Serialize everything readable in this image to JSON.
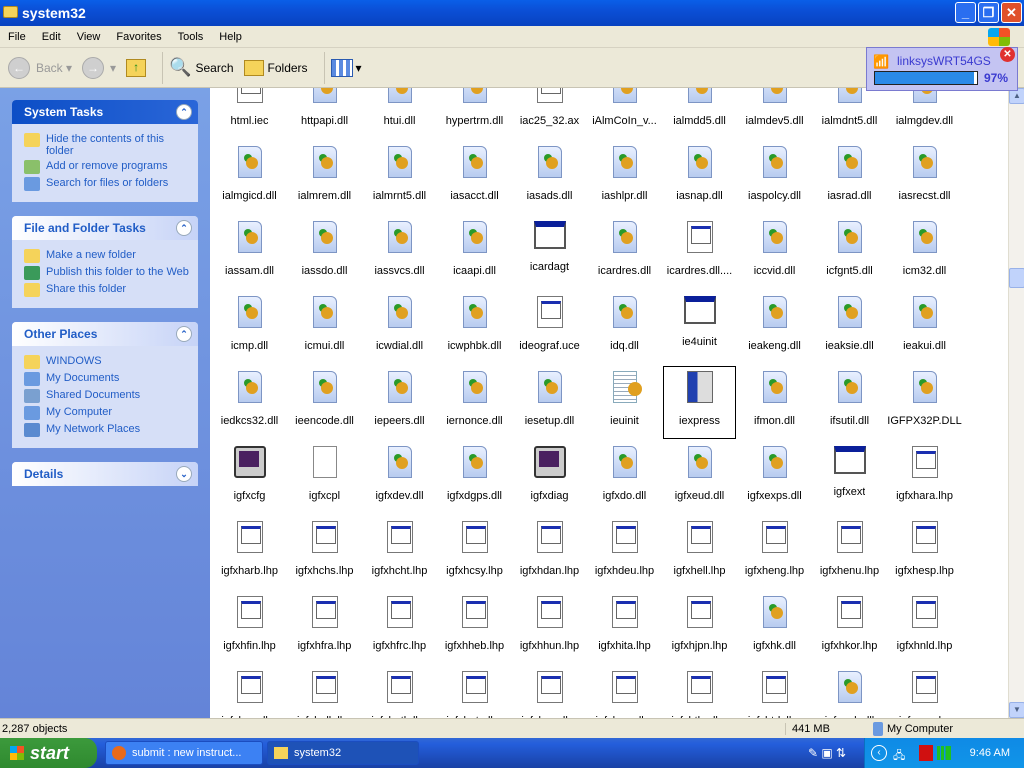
{
  "window": {
    "title": "system32"
  },
  "menu": [
    "File",
    "Edit",
    "View",
    "Favorites",
    "Tools",
    "Help"
  ],
  "toolbar": {
    "back": "Back",
    "search": "Search",
    "folders": "Folders"
  },
  "panels": [
    {
      "title": "System Tasks",
      "items": [
        "Hide the contents of this folder",
        "Add or remove programs",
        "Search for files or folders"
      ]
    },
    {
      "title": "File and Folder Tasks",
      "items": [
        "Make a new folder",
        "Publish this folder to the Web",
        "Share this folder"
      ]
    },
    {
      "title": "Other Places",
      "items": [
        "WINDOWS",
        "My Documents",
        "Shared Documents",
        "My Computer",
        "My Network Places"
      ]
    },
    {
      "title": "Details",
      "items": []
    }
  ],
  "files": [
    {
      "n": "html.iec",
      "t": "l"
    },
    {
      "n": "httpapi.dll",
      "t": "d"
    },
    {
      "n": "htui.dll",
      "t": "d"
    },
    {
      "n": "hypertrm.dll",
      "t": "d"
    },
    {
      "n": "iac25_32.ax",
      "t": "l"
    },
    {
      "n": "iAlmCoIn_v...",
      "t": "d"
    },
    {
      "n": "ialmdd5.dll",
      "t": "d"
    },
    {
      "n": "ialmdev5.dll",
      "t": "d"
    },
    {
      "n": "ialmdnt5.dll",
      "t": "d"
    },
    {
      "n": "ialmgdev.dll",
      "t": "d"
    },
    {
      "n": "ialmgicd.dll",
      "t": "d"
    },
    {
      "n": "ialmrem.dll",
      "t": "d"
    },
    {
      "n": "ialmrnt5.dll",
      "t": "d"
    },
    {
      "n": "iasacct.dll",
      "t": "d"
    },
    {
      "n": "iasads.dll",
      "t": "d"
    },
    {
      "n": "iashlpr.dll",
      "t": "d"
    },
    {
      "n": "iasnap.dll",
      "t": "d"
    },
    {
      "n": "iaspolcy.dll",
      "t": "d"
    },
    {
      "n": "iasrad.dll",
      "t": "d"
    },
    {
      "n": "iasrecst.dll",
      "t": "d"
    },
    {
      "n": "iassam.dll",
      "t": "d"
    },
    {
      "n": "iassdo.dll",
      "t": "d"
    },
    {
      "n": "iassvcs.dll",
      "t": "d"
    },
    {
      "n": "icaapi.dll",
      "t": "d"
    },
    {
      "n": "icardagt",
      "t": "w"
    },
    {
      "n": "icardres.dll",
      "t": "d"
    },
    {
      "n": "icardres.dll....",
      "t": "l"
    },
    {
      "n": "iccvid.dll",
      "t": "d"
    },
    {
      "n": "icfgnt5.dll",
      "t": "d"
    },
    {
      "n": "icm32.dll",
      "t": "d"
    },
    {
      "n": "icmp.dll",
      "t": "d"
    },
    {
      "n": "icmui.dll",
      "t": "d"
    },
    {
      "n": "icwdial.dll",
      "t": "d"
    },
    {
      "n": "icwphbk.dll",
      "t": "d"
    },
    {
      "n": "ideograf.uce",
      "t": "l"
    },
    {
      "n": "idq.dll",
      "t": "d"
    },
    {
      "n": "ie4uinit",
      "t": "w"
    },
    {
      "n": "ieakeng.dll",
      "t": "d"
    },
    {
      "n": "ieaksie.dll",
      "t": "d"
    },
    {
      "n": "ieakui.dll",
      "t": "d"
    },
    {
      "n": "iedkcs32.dll",
      "t": "d"
    },
    {
      "n": "ieencode.dll",
      "t": "d"
    },
    {
      "n": "iepeers.dll",
      "t": "d"
    },
    {
      "n": "iernonce.dll",
      "t": "d"
    },
    {
      "n": "iesetup.dll",
      "t": "d"
    },
    {
      "n": "ieuinit",
      "t": "n"
    },
    {
      "n": "iexpress",
      "t": "x",
      "sel": true
    },
    {
      "n": "ifmon.dll",
      "t": "d"
    },
    {
      "n": "ifsutil.dll",
      "t": "d"
    },
    {
      "n": "IGFPX32P.DLL",
      "t": "d"
    },
    {
      "n": "igfxcfg",
      "t": "m"
    },
    {
      "n": "igfxcpl",
      "t": "c"
    },
    {
      "n": "igfxdev.dll",
      "t": "d"
    },
    {
      "n": "igfxdgps.dll",
      "t": "d"
    },
    {
      "n": "igfxdiag",
      "t": "m"
    },
    {
      "n": "igfxdo.dll",
      "t": "d"
    },
    {
      "n": "igfxeud.dll",
      "t": "d"
    },
    {
      "n": "igfxexps.dll",
      "t": "d"
    },
    {
      "n": "igfxext",
      "t": "w"
    },
    {
      "n": "igfxhara.lhp",
      "t": "l"
    },
    {
      "n": "igfxharb.lhp",
      "t": "l"
    },
    {
      "n": "igfxhchs.lhp",
      "t": "l"
    },
    {
      "n": "igfxhcht.lhp",
      "t": "l"
    },
    {
      "n": "igfxhcsy.lhp",
      "t": "l"
    },
    {
      "n": "igfxhdan.lhp",
      "t": "l"
    },
    {
      "n": "igfxhdeu.lhp",
      "t": "l"
    },
    {
      "n": "igfxhell.lhp",
      "t": "l"
    },
    {
      "n": "igfxheng.lhp",
      "t": "l"
    },
    {
      "n": "igfxhenu.lhp",
      "t": "l"
    },
    {
      "n": "igfxhesp.lhp",
      "t": "l"
    },
    {
      "n": "igfxhfin.lhp",
      "t": "l"
    },
    {
      "n": "igfxhfra.lhp",
      "t": "l"
    },
    {
      "n": "igfxhfrc.lhp",
      "t": "l"
    },
    {
      "n": "igfxhheb.lhp",
      "t": "l"
    },
    {
      "n": "igfxhhun.lhp",
      "t": "l"
    },
    {
      "n": "igfxhita.lhp",
      "t": "l"
    },
    {
      "n": "igfxhjpn.lhp",
      "t": "l"
    },
    {
      "n": "igfxhk.dll",
      "t": "d"
    },
    {
      "n": "igfxhkor.lhp",
      "t": "l"
    },
    {
      "n": "igfxhnld.lhp",
      "t": "l"
    },
    {
      "n": "igfxhnor.lhp",
      "t": "l"
    },
    {
      "n": "igfxhplk.lhp",
      "t": "l"
    },
    {
      "n": "igfxhptb.lhp",
      "t": "l"
    },
    {
      "n": "igfxhptg.lhp",
      "t": "l"
    },
    {
      "n": "igfxhrus.lhp",
      "t": "l"
    },
    {
      "n": "igfxhsve.lhp",
      "t": "l"
    },
    {
      "n": "igfxhtha.lhp",
      "t": "l"
    },
    {
      "n": "igfxhtrk.lhp",
      "t": "l"
    },
    {
      "n": "igfxpph.dll",
      "t": "d"
    },
    {
      "n": "igfxrara.lrc",
      "t": "l"
    }
  ],
  "status": {
    "objects": "2,287 objects",
    "size": "441 MB",
    "location": "My Computer"
  },
  "taskbar": {
    "start": "start",
    "tasks": [
      "submit : new instruct...",
      "system32"
    ],
    "clock": "9:46 AM"
  },
  "balloon": {
    "network": "linksysWRT54GS",
    "percent_label": "97%",
    "progress": 97
  }
}
